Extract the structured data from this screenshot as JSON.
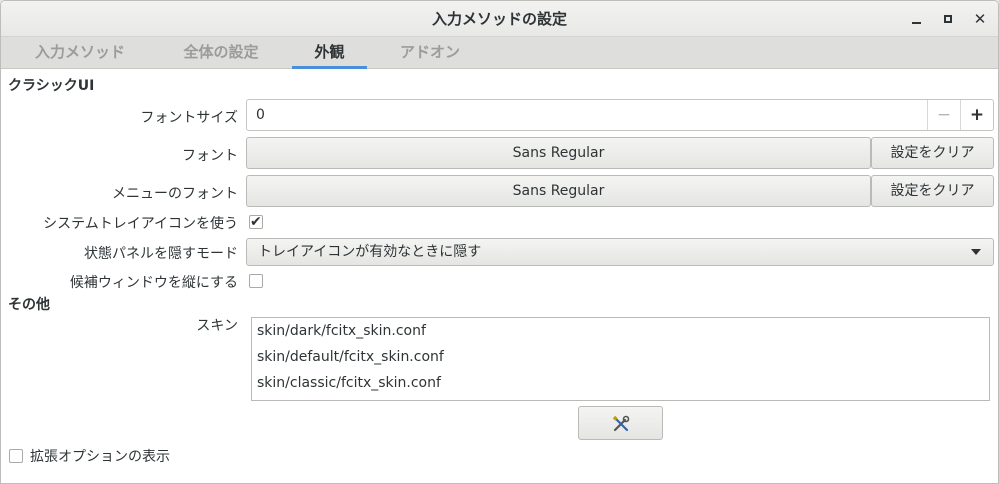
{
  "window": {
    "title": "入力メソッドの設定",
    "minimize_label": "minimize",
    "maximize_label": "maximize",
    "close_label": "✕"
  },
  "tabs": [
    {
      "label": "入力メソッド",
      "active": false
    },
    {
      "label": "全体の設定",
      "active": false
    },
    {
      "label": "外観",
      "active": true
    },
    {
      "label": "アドオン",
      "active": false
    }
  ],
  "classic_ui": {
    "heading": "クラシックUI",
    "font_size": {
      "label": "フォントサイズ",
      "value": "0",
      "minus": "−",
      "plus": "+"
    },
    "font": {
      "label": "フォント",
      "value": "Sans Regular",
      "clear": "設定をクリア"
    },
    "menu_font": {
      "label": "メニューのフォント",
      "value": "Sans Regular",
      "clear": "設定をクリア"
    },
    "use_tray_icon": {
      "label": "システムトレイアイコンを使う",
      "checked": true,
      "mark": "✔"
    },
    "hide_panel_mode": {
      "label": "状態パネルを隠すモード",
      "value": "トレイアイコンが有効なときに隠す"
    },
    "vertical_candidate": {
      "label": "候補ウィンドウを縦にする",
      "checked": false
    }
  },
  "other": {
    "heading": "その他",
    "skin": {
      "label": "スキン",
      "items": [
        "skin/dark/fcitx_skin.conf",
        "skin/default/fcitx_skin.conf",
        "skin/classic/fcitx_skin.conf"
      ]
    }
  },
  "advanced": {
    "label": "拡張オプションの表示",
    "checked": false
  },
  "colors": {
    "accent": "#4a90d9",
    "text": "#2e3436",
    "inactive_tab": "#9a9d98"
  }
}
